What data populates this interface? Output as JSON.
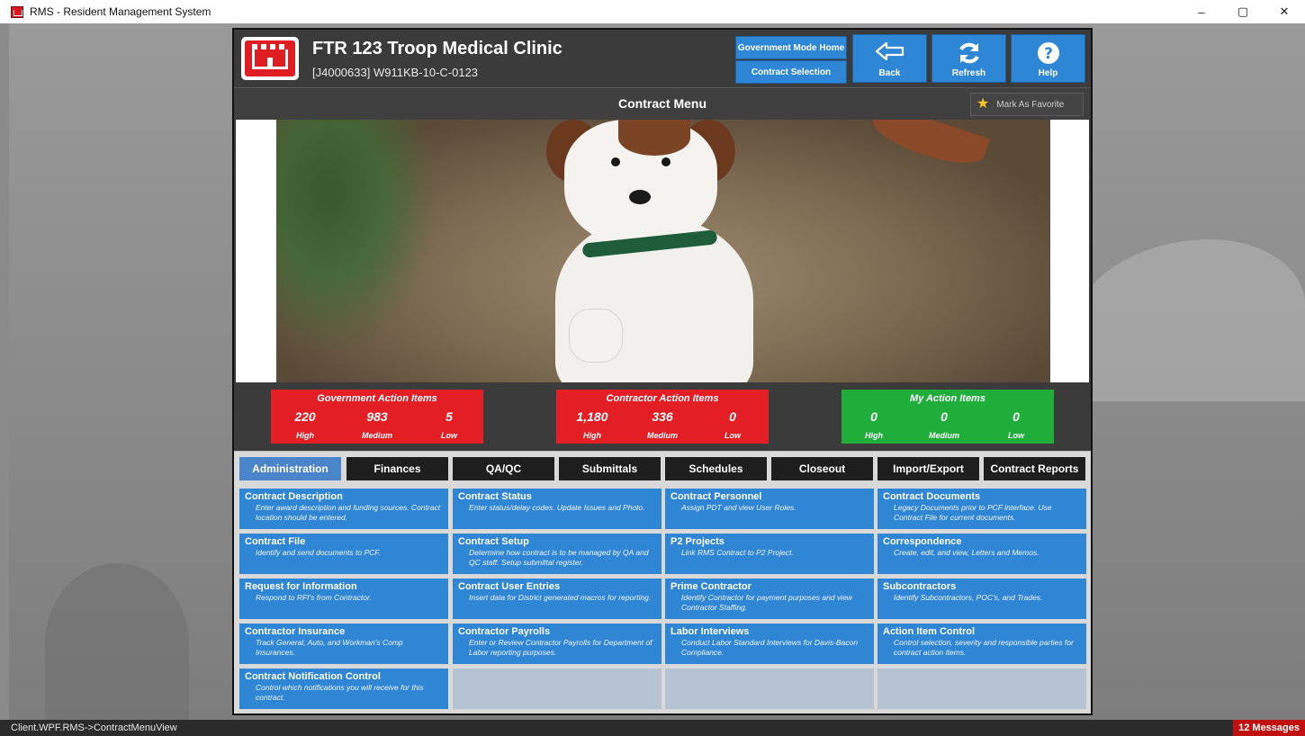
{
  "window": {
    "title": "RMS - Resident Management System",
    "minimize": "–",
    "restore": "▢",
    "close": "✕"
  },
  "header": {
    "project_title": "FTR 123 Troop Medical Clinic",
    "contract_id": "[J4000633] W911KB-10-C-0123",
    "gov_mode_home": "Government Mode Home",
    "contract_selection": "Contract Selection",
    "back": "Back",
    "refresh": "Refresh",
    "help": "Help"
  },
  "menu": {
    "title": "Contract Menu",
    "favorite": "Mark As Favorite"
  },
  "action_items": {
    "government": {
      "title": "Government Action Items",
      "high": "220",
      "medium": "983",
      "low": "5"
    },
    "contractor": {
      "title": "Contractor Action Items",
      "high": "1,180",
      "medium": "336",
      "low": "0"
    },
    "mine": {
      "title": "My Action Items",
      "high": "0",
      "medium": "0",
      "low": "0"
    },
    "labels": {
      "high": "High",
      "medium": "Medium",
      "low": "Low"
    }
  },
  "tabs": [
    "Administration",
    "Finances",
    "QA/QC",
    "Submittals",
    "Schedules",
    "Closeout",
    "Import/Export",
    "Contract Reports"
  ],
  "tiles": [
    {
      "title": "Contract Description",
      "desc": "Enter award description and funding sources. Contract location should be entered."
    },
    {
      "title": "Contract Status",
      "desc": "Enter status/delay codes. Update Issues and Photo."
    },
    {
      "title": "Contract Personnel",
      "desc": "Assign PDT and view User Roles."
    },
    {
      "title": "Contract Documents",
      "desc": "Legacy Documents prior to PCF interface. Use Contract File for current documents."
    },
    {
      "title": "Contract File",
      "desc": "Identify and send documents to PCF."
    },
    {
      "title": "Contract Setup",
      "desc": "Determine how contract is to be managed by QA and QC staff. Setup submittal register."
    },
    {
      "title": "P2 Projects",
      "desc": "Link RMS Contract to P2 Project."
    },
    {
      "title": "Correspondence",
      "desc": "Create, edit, and view, Letters and Memos."
    },
    {
      "title": "Request for Information",
      "desc": "Respond to RFI's from Contractor."
    },
    {
      "title": "Contract User Entries",
      "desc": "Insert data for District generated macros for reporting."
    },
    {
      "title": "Prime Contractor",
      "desc": "Identify Contractor for payment purposes and view Contractor Staffing."
    },
    {
      "title": "Subcontractors",
      "desc": "Identify Subcontractors, POC's, and Trades."
    },
    {
      "title": "Contractor Insurance",
      "desc": "Track General, Auto, and Workman's Comp Insurances."
    },
    {
      "title": "Contractor Payrolls",
      "desc": "Enter or Review Contractor Payrolls for Department of Labor reporting purposes."
    },
    {
      "title": "Labor Interviews",
      "desc": "Conduct Labor Standard Interviews for Davis-Bacon Compliance."
    },
    {
      "title": "Action Item Control",
      "desc": "Control selection, severity and responsible parties for contract action items."
    },
    {
      "title": "Contract Notification Control",
      "desc": "Control which notifications you will receive for this contract."
    }
  ],
  "status": {
    "path": "Client.WPF.RMS->ContractMenuView",
    "messages": "12 Messages"
  },
  "colors": {
    "accent_blue": "#2e86d6",
    "active_tab": "#4a84c9",
    "alert_red": "#e31f25",
    "ok_green": "#1fae3a"
  }
}
